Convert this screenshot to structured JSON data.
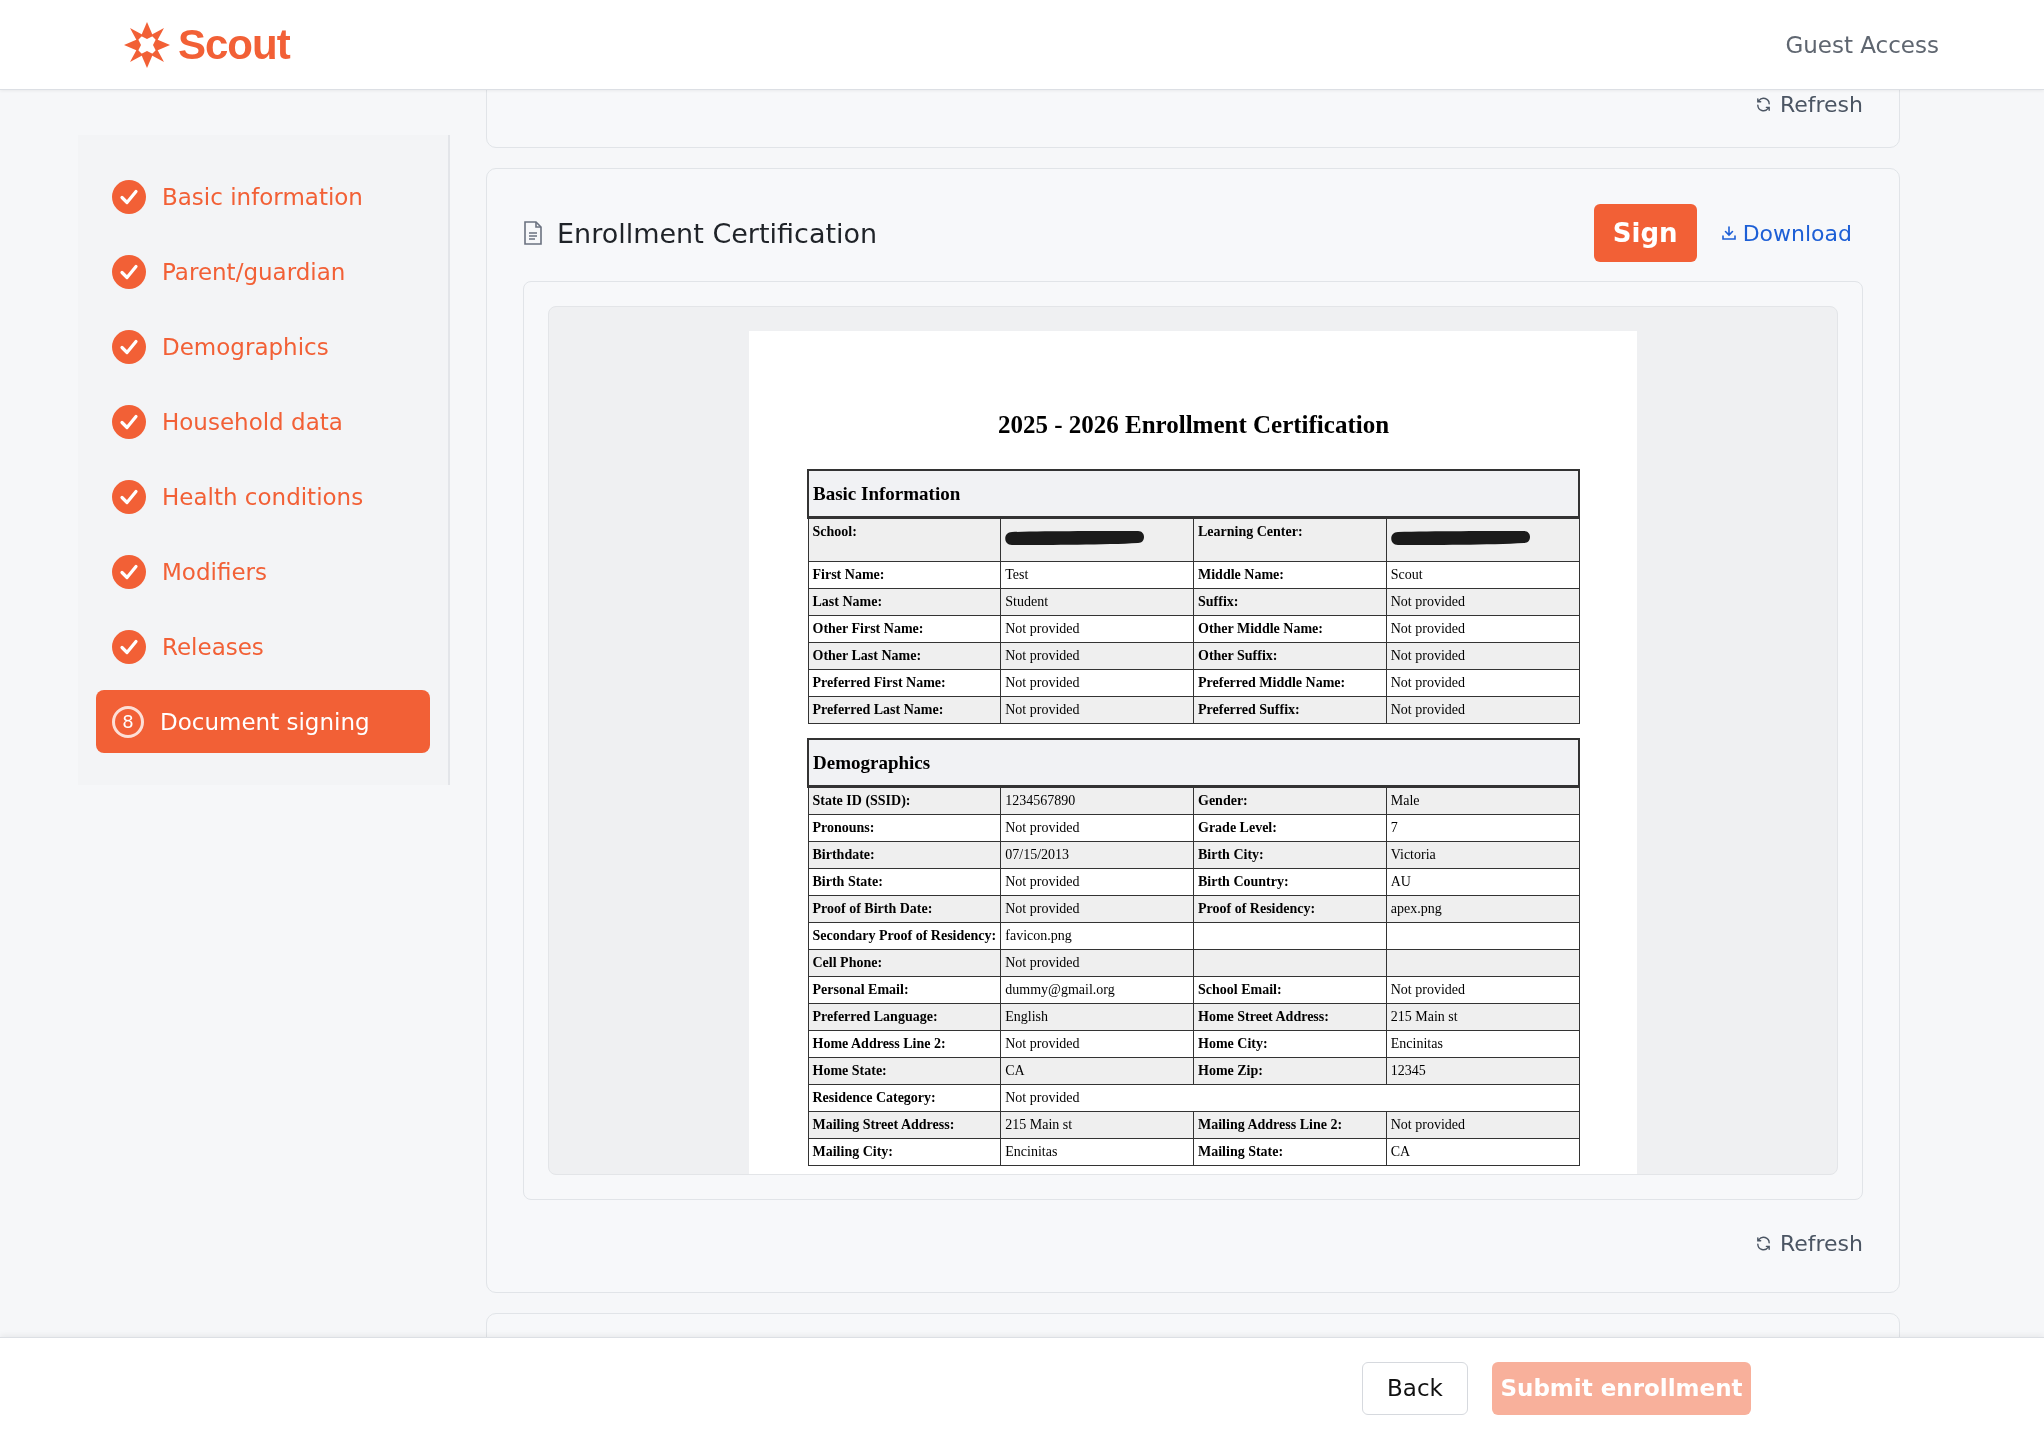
{
  "header": {
    "brand": "Scout",
    "account": "Guest Access"
  },
  "sidebar": {
    "items": [
      {
        "label": "Basic information",
        "completed": true,
        "selected": false
      },
      {
        "label": "Parent/guardian",
        "completed": true,
        "selected": false
      },
      {
        "label": "Demographics",
        "completed": true,
        "selected": false
      },
      {
        "label": "Household data",
        "completed": true,
        "selected": false
      },
      {
        "label": "Health conditions",
        "completed": true,
        "selected": false
      },
      {
        "label": "Modifiers",
        "completed": true,
        "selected": false
      },
      {
        "label": "Releases",
        "completed": true,
        "selected": false
      },
      {
        "label": "Document signing",
        "completed": false,
        "selected": true,
        "step": "8"
      }
    ]
  },
  "previous_card": {
    "refresh": "Refresh"
  },
  "document_card": {
    "title": "Enrollment Certification",
    "sign": "Sign",
    "download": "Download",
    "refresh": "Refresh",
    "document": {
      "title": "2025 - 2026 Enrollment Certification",
      "sections": [
        {
          "heading": "Basic Information",
          "rows": [
            {
              "cells": [
                {
                  "kind": "label",
                  "text": "School:"
                },
                {
                  "kind": "redacted"
                },
                {
                  "kind": "label",
                  "text": "Learning Center:"
                },
                {
                  "kind": "redacted"
                }
              ]
            },
            {
              "cells": [
                {
                  "kind": "label",
                  "text": "First Name:"
                },
                {
                  "kind": "value",
                  "text": "Test"
                },
                {
                  "kind": "label",
                  "text": "Middle Name:"
                },
                {
                  "kind": "value",
                  "text": "Scout"
                }
              ]
            },
            {
              "cells": [
                {
                  "kind": "label",
                  "text": "Last Name:"
                },
                {
                  "kind": "value",
                  "text": "Student"
                },
                {
                  "kind": "label",
                  "text": "Suffix:"
                },
                {
                  "kind": "value",
                  "text": "Not provided"
                }
              ]
            },
            {
              "cells": [
                {
                  "kind": "label",
                  "text": "Other First Name:"
                },
                {
                  "kind": "value",
                  "text": "Not provided"
                },
                {
                  "kind": "label",
                  "text": "Other Middle Name:"
                },
                {
                  "kind": "value",
                  "text": "Not provided"
                }
              ]
            },
            {
              "cells": [
                {
                  "kind": "label",
                  "text": "Other Last Name:"
                },
                {
                  "kind": "value",
                  "text": "Not provided"
                },
                {
                  "kind": "label",
                  "text": "Other Suffix:"
                },
                {
                  "kind": "value",
                  "text": "Not provided"
                }
              ]
            },
            {
              "cells": [
                {
                  "kind": "label",
                  "text": "Preferred First Name:"
                },
                {
                  "kind": "value",
                  "text": "Not provided"
                },
                {
                  "kind": "label",
                  "text": "Preferred Middle Name:"
                },
                {
                  "kind": "value",
                  "text": "Not provided"
                }
              ]
            },
            {
              "cells": [
                {
                  "kind": "label",
                  "text": "Preferred Last Name:"
                },
                {
                  "kind": "value",
                  "text": "Not provided"
                },
                {
                  "kind": "label",
                  "text": "Preferred Suffix:"
                },
                {
                  "kind": "value",
                  "text": "Not provided"
                }
              ]
            }
          ]
        },
        {
          "heading": "Demographics",
          "rows": [
            {
              "cells": [
                {
                  "kind": "label",
                  "text": "State ID (SSID):"
                },
                {
                  "kind": "value",
                  "text": "1234567890"
                },
                {
                  "kind": "label",
                  "text": "Gender:"
                },
                {
                  "kind": "value",
                  "text": "Male"
                }
              ]
            },
            {
              "cells": [
                {
                  "kind": "label",
                  "text": "Pronouns:"
                },
                {
                  "kind": "value",
                  "text": "Not provided"
                },
                {
                  "kind": "label",
                  "text": "Grade Level:"
                },
                {
                  "kind": "value",
                  "text": "7"
                }
              ]
            },
            {
              "cells": [
                {
                  "kind": "label",
                  "text": "Birthdate:"
                },
                {
                  "kind": "value",
                  "text": "07/15/2013"
                },
                {
                  "kind": "label",
                  "text": "Birth City:"
                },
                {
                  "kind": "value",
                  "text": "Victoria"
                }
              ]
            },
            {
              "cells": [
                {
                  "kind": "label",
                  "text": "Birth State:"
                },
                {
                  "kind": "value",
                  "text": "Not provided"
                },
                {
                  "kind": "label",
                  "text": "Birth Country:"
                },
                {
                  "kind": "value",
                  "text": "AU"
                }
              ]
            },
            {
              "cells": [
                {
                  "kind": "label",
                  "text": "Proof of Birth Date:"
                },
                {
                  "kind": "value",
                  "text": "Not provided"
                },
                {
                  "kind": "label",
                  "text": "Proof of Residency:"
                },
                {
                  "kind": "value",
                  "text": "apex.png"
                }
              ]
            },
            {
              "cells": [
                {
                  "kind": "label",
                  "text": "Secondary Proof of Residency:"
                },
                {
                  "kind": "value",
                  "text": "favicon.png"
                },
                {
                  "kind": "empty"
                },
                {
                  "kind": "empty"
                }
              ]
            },
            {
              "cells": [
                {
                  "kind": "label",
                  "text": "Cell Phone:"
                },
                {
                  "kind": "value",
                  "text": "Not provided"
                },
                {
                  "kind": "empty"
                },
                {
                  "kind": "empty"
                }
              ]
            },
            {
              "cells": [
                {
                  "kind": "label",
                  "text": "Personal Email:"
                },
                {
                  "kind": "value",
                  "text": "dummy@gmail.org"
                },
                {
                  "kind": "label",
                  "text": "School Email:"
                },
                {
                  "kind": "value",
                  "text": "Not provided"
                }
              ]
            },
            {
              "cells": [
                {
                  "kind": "label",
                  "text": "Preferred Language:"
                },
                {
                  "kind": "value",
                  "text": "English"
                },
                {
                  "kind": "label",
                  "text": "Home Street Address:"
                },
                {
                  "kind": "value",
                  "text": "215 Main st"
                }
              ]
            },
            {
              "cells": [
                {
                  "kind": "label",
                  "text": "Home Address Line 2:"
                },
                {
                  "kind": "value",
                  "text": "Not provided"
                },
                {
                  "kind": "label",
                  "text": "Home City:"
                },
                {
                  "kind": "value",
                  "text": "Encinitas"
                }
              ]
            },
            {
              "cells": [
                {
                  "kind": "label",
                  "text": "Home State:"
                },
                {
                  "kind": "value",
                  "text": "CA"
                },
                {
                  "kind": "label",
                  "text": "Home Zip:"
                },
                {
                  "kind": "value",
                  "text": "12345"
                }
              ]
            },
            {
              "cells": [
                {
                  "kind": "label",
                  "text": "Residence Category:"
                },
                {
                  "kind": "wide",
                  "text": "Not provided"
                },
                {
                  "kind": "blank"
                },
                {
                  "kind": "blank"
                }
              ]
            },
            {
              "cells": [
                {
                  "kind": "label",
                  "text": "Mailing Street Address:"
                },
                {
                  "kind": "value",
                  "text": "215 Main st"
                },
                {
                  "kind": "label",
                  "text": "Mailing Address Line 2:"
                },
                {
                  "kind": "value",
                  "text": "Not provided"
                }
              ]
            },
            {
              "cells": [
                {
                  "kind": "label",
                  "text": "Mailing City:"
                },
                {
                  "kind": "value",
                  "text": "Encinitas"
                },
                {
                  "kind": "label",
                  "text": "Mailing State:"
                },
                {
                  "kind": "value",
                  "text": "CA"
                }
              ]
            }
          ]
        }
      ]
    }
  },
  "footer": {
    "back": "Back",
    "submit": {
      "label": "Submit enrollment",
      "disabled": true
    }
  }
}
